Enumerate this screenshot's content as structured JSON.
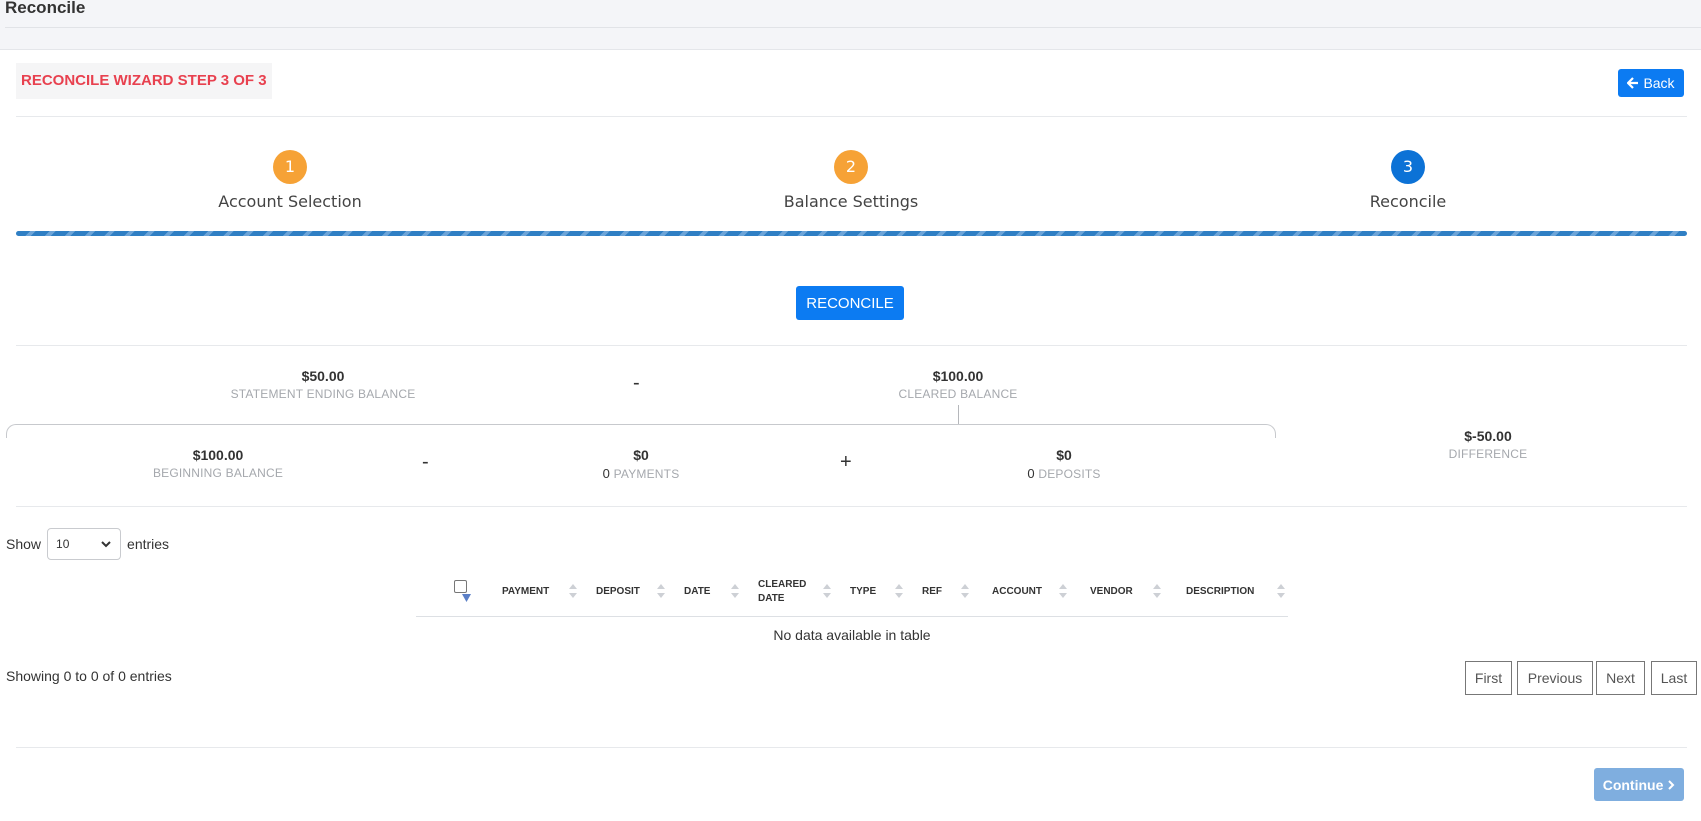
{
  "header": {
    "title": "Reconcile"
  },
  "wizard": {
    "title": "RECONCILE WIZARD STEP 3 OF 3",
    "back_label": "Back"
  },
  "steps": [
    {
      "number": "1",
      "label": "Account Selection",
      "state": "done"
    },
    {
      "number": "2",
      "label": "Balance Settings",
      "state": "done"
    },
    {
      "number": "3",
      "label": "Reconcile",
      "state": "active"
    }
  ],
  "actions": {
    "reconcile_label": "RECONCILE",
    "continue_label": "Continue"
  },
  "balances": {
    "statement_ending": {
      "value": "$50.00",
      "label": "STATEMENT ENDING BALANCE"
    },
    "cleared": {
      "value": "$100.00",
      "label": "CLEARED BALANCE"
    },
    "beginning": {
      "value": "$100.00",
      "label": "BEGINNING BALANCE"
    },
    "payments": {
      "value": "$0",
      "count": "0",
      "label": "PAYMENTS"
    },
    "deposits": {
      "value": "$0",
      "count": "0",
      "label": "DEPOSITS"
    },
    "difference": {
      "value": "$-50.00",
      "label": "DIFFERENCE"
    },
    "op_minus": "-",
    "op_plus": "+"
  },
  "table": {
    "show_label": "Show",
    "entries_label": "entries",
    "page_size": "10",
    "columns": [
      "PAYMENT",
      "DEPOSIT",
      "DATE",
      "CLEARED DATE",
      "TYPE",
      "REF",
      "ACCOUNT",
      "VENDOR",
      "DESCRIPTION"
    ],
    "empty_message": "No data available in table",
    "info": "Showing 0 to 0 of 0 entries"
  },
  "pagination": {
    "first": "First",
    "previous": "Previous",
    "next": "Next",
    "last": "Last"
  },
  "colors": {
    "accent": "#0c7bf2",
    "step_done": "#f6a236",
    "step_active": "#0c72d6",
    "title_red": "#e8414f"
  },
  "icons": {
    "back": "arrow-left-icon",
    "continue": "chevron-right-icon",
    "select": "chevron-down-icon",
    "sort": "sort-icon"
  }
}
